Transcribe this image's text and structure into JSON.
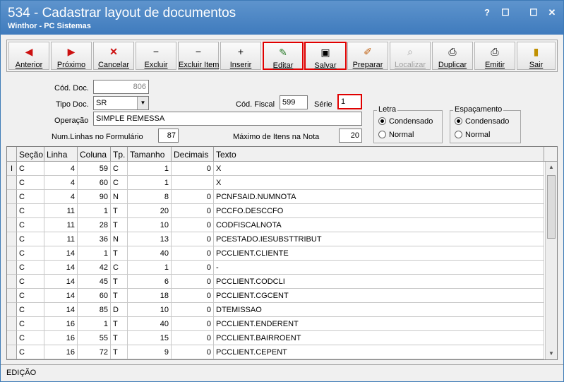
{
  "window": {
    "title": "534 - Cadastrar layout de documentos",
    "subtitle": "Winthor - PC Sistemas",
    "help": "?",
    "restore": "☐",
    "minimize": "☐",
    "close": "✕"
  },
  "toolbar": {
    "anterior": "Anterior",
    "proximo": "Próximo",
    "cancelar": "Cancelar",
    "excluir": "Excluir",
    "excluir_item": "Excluir Item",
    "inserir": "Inserir",
    "editar": "Editar",
    "salvar": "Salvar",
    "preparar": "Preparar",
    "localizar": "Localizar",
    "duplicar": "Duplicar",
    "emitir": "Emitir",
    "sair": "Sair"
  },
  "form": {
    "cod_doc_label": "Cód. Doc.",
    "cod_doc_value": "806",
    "tipo_doc_label": "Tipo Doc.",
    "tipo_doc_value": "SR",
    "cod_fiscal_label": "Cód. Fiscal",
    "cod_fiscal_value": "599",
    "serie_label": "Série",
    "serie_value": "1",
    "operacao_label": "Operação",
    "operacao_value": "SIMPLE REMESSA",
    "num_linhas_label": "Num.Linhas no Formulário",
    "num_linhas_value": "87",
    "max_itens_label": "Máximo de Itens na Nota",
    "max_itens_value": "20"
  },
  "letra": {
    "title": "Letra",
    "opt1": "Condensado",
    "opt2": "Normal",
    "selected": "Condensado"
  },
  "espacamento": {
    "title": "Espaçamento",
    "opt1": "Condensado",
    "opt2": "Normal",
    "selected": "Condensado"
  },
  "grid": {
    "headers": [
      "Seção",
      "Linha",
      "Coluna",
      "Tp.",
      "Tamanho",
      "Decimais",
      "Texto"
    ],
    "rows": [
      [
        "C",
        "4",
        "59",
        "C",
        "1",
        "0",
        "X"
      ],
      [
        "C",
        "4",
        "60",
        "C",
        "1",
        "",
        "X"
      ],
      [
        "C",
        "4",
        "90",
        "N",
        "8",
        "0",
        "PCNFSAID.NUMNOTA"
      ],
      [
        "C",
        "11",
        "1",
        "T",
        "20",
        "0",
        "PCCFO.DESCCFO"
      ],
      [
        "C",
        "11",
        "28",
        "T",
        "10",
        "0",
        "CODFISCALNOTA"
      ],
      [
        "C",
        "11",
        "36",
        "N",
        "13",
        "0",
        "PCESTADO.IESUBSTTRIBUT"
      ],
      [
        "C",
        "14",
        "1",
        "T",
        "40",
        "0",
        "PCCLIENT.CLIENTE"
      ],
      [
        "C",
        "14",
        "42",
        "C",
        "1",
        "0",
        "-"
      ],
      [
        "C",
        "14",
        "45",
        "T",
        "6",
        "0",
        "PCCLIENT.CODCLI"
      ],
      [
        "C",
        "14",
        "60",
        "T",
        "18",
        "0",
        "PCCLIENT.CGCENT"
      ],
      [
        "C",
        "14",
        "85",
        "D",
        "10",
        "0",
        "DTEMISSAO"
      ],
      [
        "C",
        "16",
        "1",
        "T",
        "40",
        "0",
        "PCCLIENT.ENDERENT"
      ],
      [
        "C",
        "16",
        "55",
        "T",
        "15",
        "0",
        "PCCLIENT.BAIRROENT"
      ],
      [
        "C",
        "16",
        "72",
        "T",
        "9",
        "0",
        "PCCLIENT.CEPENT"
      ]
    ],
    "current_row_marker": "I"
  },
  "status": {
    "mode": "EDIÇÃO"
  }
}
